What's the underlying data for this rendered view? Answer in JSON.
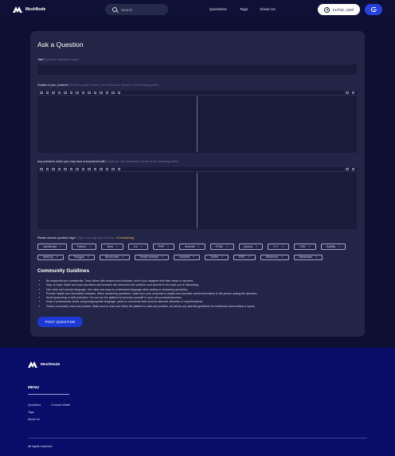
{
  "header": {
    "logo_text": "MeshNode",
    "search_placeholder": "Search",
    "nav": [
      "Questions",
      "Tags",
      "About Us"
    ],
    "wallet_address": "0x7f4d...b33f"
  },
  "form": {
    "title": "Ask a Question",
    "title_label": "Title*",
    "title_hint": "(Must be relevant to topic)",
    "details_label": "Details of your problem*",
    "details_hint": "(Please explain clearly. Use Markdown Syntax in the following editor)",
    "solutions_label": "Any solutions which you may have encountered with",
    "solutions_hint": "(Optional. Use Markdown Syntax in the following editor)",
    "tags_label": "Please choose question tags*",
    "tags_hint": "(Type your tags and hit Enter,",
    "tags_remaining": "10 remaining)",
    "tags": [
      "JavaScript",
      "Python",
      "Java",
      "C#",
      "PHP",
      "Android",
      "HTML",
      "jQuery",
      "C++",
      "CSS",
      "Solidity",
      "Web3.js",
      "Polygon",
      "Blockchain",
      "Smart contract",
      "Hardhat",
      "Truffle",
      "ERC",
      "Ethereum",
      "Metamask"
    ],
    "post_button": "POST QUESTION"
  },
  "guidelines": {
    "title": "Community Guidlines",
    "rules": [
      "Be respectful and considerate: Treat others with respect and kindness, even if you disagree with their views or opinions.",
      "Stay on topic: Make sure your questions and answers are relevant to the platform and specific to the topic you're discussing.",
      "Use clear and concise language: Use clear and easy-to-understand language when asking or answering questions.",
      "Provide helpful and informative answers: When answering questions, make sure your response is helpful and provides useful information to the person asking the question.",
      "Avoid spamming or self-promotion: Do not use the platform to promote yourself or your own products/services.",
      "Keep it professional: Avoid using inappropriate language, jokes or comments that could be deemed offensive or unprofessional.",
      "Follow community rules and policies: Make sure to read and follow the platform's rules and policies, as well as any specific guidelines for individual communities or topics."
    ]
  },
  "footer": {
    "logo_text": "MeshNode",
    "menu_title": "MENU",
    "links": [
      "Questions",
      "Connect Wallet",
      "Tags",
      "About Us"
    ],
    "copyright": "All rights reserved"
  },
  "colors": {
    "background": "#0d1030",
    "card": "#222546",
    "accent": "#1c39d6",
    "footer": "#0a0d68",
    "highlight": "#e8c04a"
  }
}
